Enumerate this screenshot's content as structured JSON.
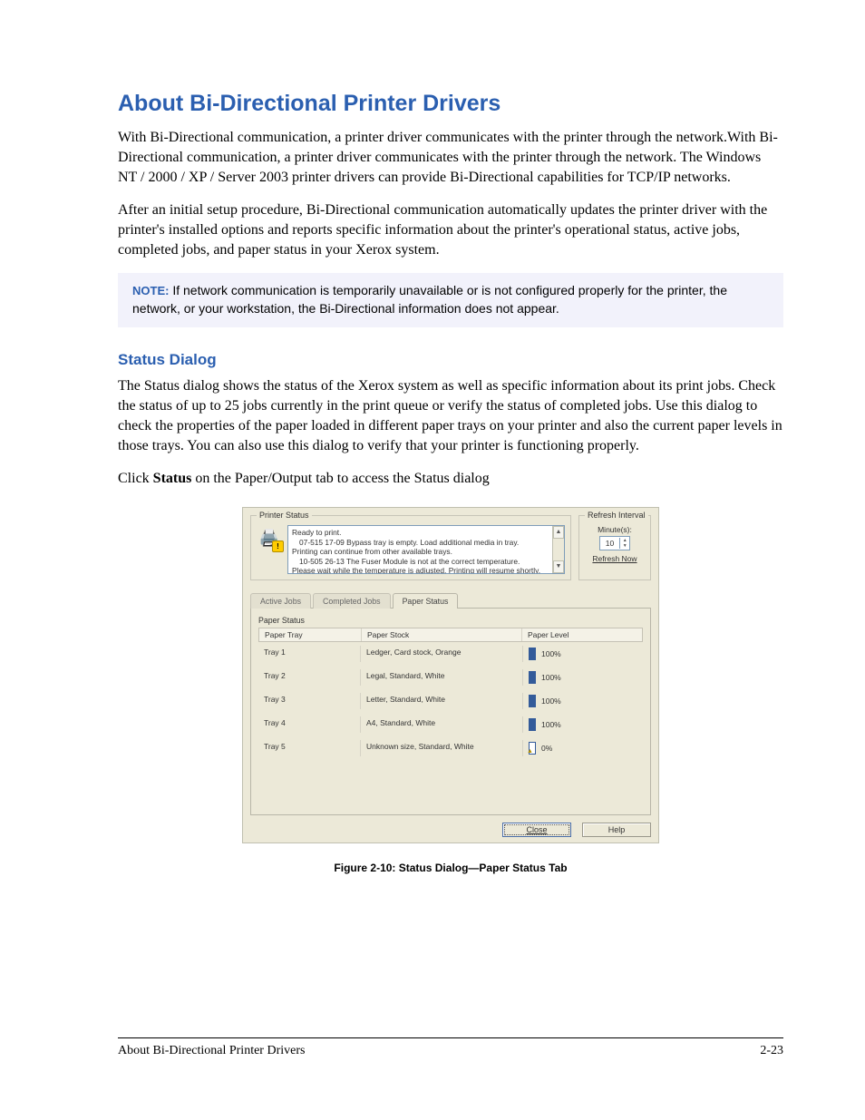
{
  "heading": "About Bi-Directional Printer Drivers",
  "para1": "With Bi-Directional communication, a printer driver communicates with the printer through the network.With Bi-Directional communication, a printer driver communicates with the printer through the network. The Windows NT / 2000 / XP / Server 2003 printer drivers can provide Bi-Directional capabilities for TCP/IP networks.",
  "para2": "After an initial setup procedure, Bi-Directional communication automatically updates the printer driver with the printer's installed options and reports specific information about the printer's operational status, active jobs, completed jobs, and paper status in your Xerox system.",
  "note_label": "NOTE:",
  "note_text": " If network communication is temporarily unavailable or is not configured properly for the printer, the network, or your workstation, the Bi-Directional information does not appear.",
  "sub_heading": "Status Dialog",
  "para3": "The Status dialog shows the status of the Xerox system as well as specific information about its print jobs. Check the status of up to 25 jobs currently in the print queue or verify the status of completed jobs. Use this dialog to check the properties of the paper loaded in different paper trays on your printer and also the current paper levels in those trays. You can also use this dialog to verify that your printer is functioning properly.",
  "para4_pre": "Click ",
  "para4_bold": "Status",
  "para4_post": " on the Paper/Output tab to access the Status dialog",
  "dialog": {
    "printer_status_legend": "Printer Status",
    "status_lines": {
      "l1": "Ready to print.",
      "l2": "07-515 17-09 Bypass tray is empty. Load additional media in tray.",
      "l3": "Printing can continue from other available trays.",
      "l4": "10-505 26-13 The Fuser Module is not at the correct temperature.",
      "l5": "Please wait while the temperature is adjusted. Printing will resume shortly."
    },
    "refresh_legend": "Refresh Interval",
    "refresh_minutes_label": "Minute(s):",
    "refresh_value": "10",
    "refresh_now": "Refresh Now",
    "tabs": {
      "active": "Active Jobs",
      "completed": "Completed Jobs",
      "paper": "Paper Status"
    },
    "panel_legend": "Paper Status",
    "columns": {
      "tray": "Paper Tray",
      "stock": "Paper Stock",
      "level": "Paper Level"
    },
    "rows": [
      {
        "tray": "Tray 1",
        "stock": "Ledger, Card stock, Orange",
        "level": "100%",
        "fill": 100
      },
      {
        "tray": "Tray 2",
        "stock": "Legal, Standard, White",
        "level": "100%",
        "fill": 100
      },
      {
        "tray": "Tray 3",
        "stock": "Letter, Standard, White",
        "level": "100%",
        "fill": 100
      },
      {
        "tray": "Tray 4",
        "stock": "A4, Standard, White",
        "level": "100%",
        "fill": 100
      },
      {
        "tray": "Tray 5",
        "stock": "Unknown size, Standard, White",
        "level": "0%",
        "fill": 0
      }
    ],
    "buttons": {
      "close": "Close",
      "help": "Help"
    }
  },
  "figure_caption": "Figure 2-10:  Status Dialog—Paper Status Tab",
  "footer_left": "About Bi-Directional Printer Drivers",
  "footer_right": "2-23"
}
